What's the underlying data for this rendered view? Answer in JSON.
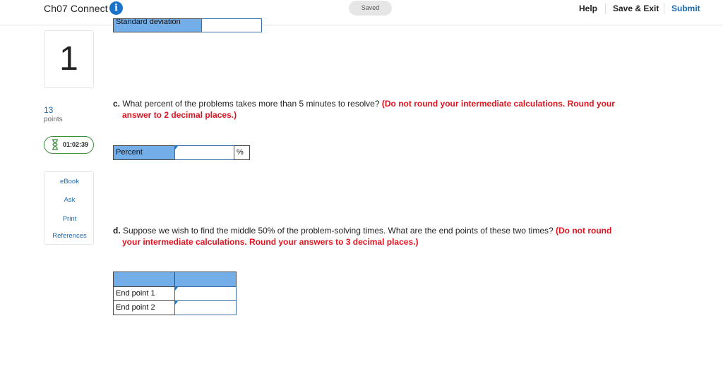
{
  "header": {
    "title": "Ch07 Connect",
    "saved_status": "Saved",
    "help": "Help",
    "save_exit": "Save & Exit",
    "submit": "Submit",
    "accent_color": "#1a6ab0"
  },
  "sidebar": {
    "question_number": "1",
    "points_value": "13",
    "points_label": "points",
    "timer": "01:02:39",
    "tools": [
      "eBook",
      "Ask",
      "Print",
      "References"
    ]
  },
  "main": {
    "partial_label": "Standard deviation",
    "question_c": {
      "lead": "c.",
      "text": " What percent of the problems takes more than 5 minutes to resolve? ",
      "warning_line1": "(Do not round your intermediate calculations. Round your",
      "warning_line2": "answer to 2 decimal places.)"
    },
    "percent_table": {
      "label": "Percent",
      "value": "",
      "unit": "%"
    },
    "question_d": {
      "lead": "d.",
      "text": " Suppose we wish to find the middle 50% of the problem-solving times. What are the end points of these two times? ",
      "warning_line1": "(Do not round",
      "warning_line2": "your intermediate calculations. Round your answers to 3 decimal places.)"
    },
    "endpoint_table": {
      "rows": [
        {
          "label": "End point 1",
          "value": ""
        },
        {
          "label": "End point 2",
          "value": ""
        }
      ]
    }
  }
}
